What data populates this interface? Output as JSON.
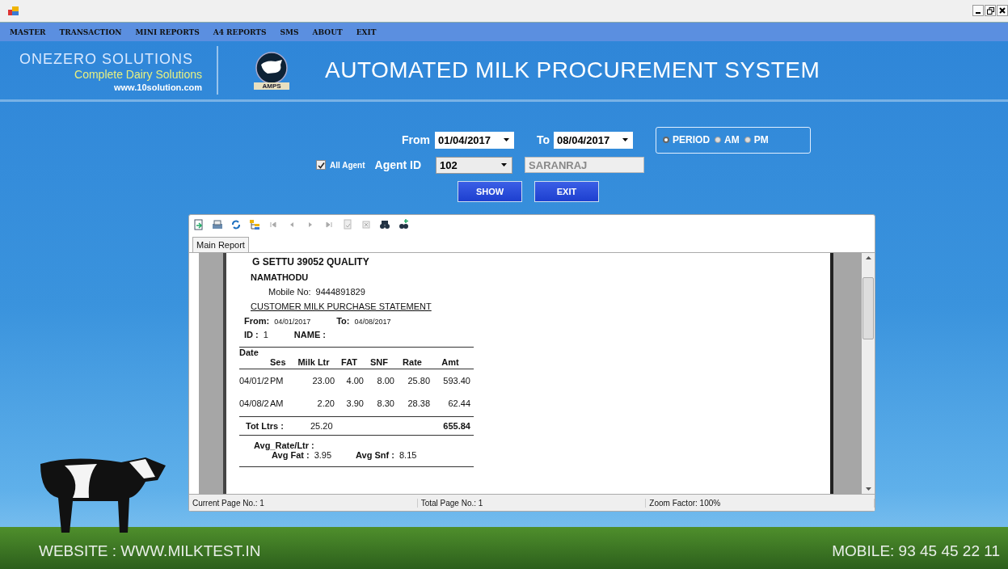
{
  "menu": [
    "MASTER",
    "TRANSACTION",
    "MINI REPORTS",
    "A4 REPORTS",
    "SMS",
    "ABOUT",
    "EXIT"
  ],
  "header": {
    "company": "ONEZERO SOLUTIONS",
    "tagline": "Complete Dairy Solutions",
    "website": "www.10solution.com",
    "logo_text": "AMPS",
    "title": "AUTOMATED MILK PROCUREMENT SYSTEM"
  },
  "filter": {
    "from_label": "From",
    "from_value": "01/04/2017",
    "to_label": "To",
    "to_value": "08/04/2017",
    "sessions": [
      {
        "label": "PERIOD",
        "selected": true
      },
      {
        "label": "AM",
        "selected": false
      },
      {
        "label": "PM",
        "selected": false
      }
    ],
    "all_agent": {
      "label": "All Agent",
      "checked": true
    },
    "agent_label": "Agent ID",
    "agent_id": "102",
    "agent_name": "SARANRAJ",
    "buttons": [
      "SHOW",
      "EXIT"
    ]
  },
  "report_viewer": {
    "tab": "Main Report",
    "report": {
      "company": "G SETTU 39052 QUALITY",
      "place": "NAMATHODU",
      "mobile_label": "Mobile No:",
      "mobile": "9444891829",
      "heading": "CUSTOMER MILK PURCHASE STATEMENT",
      "from_label": "From:",
      "from": "04/01/2017",
      "to_label": "To:",
      "to": "04/08/2017",
      "id_label": "ID :",
      "id": "1",
      "name_label": "NAME :",
      "columns": [
        "Date",
        "Ses",
        "Milk Ltr",
        "FAT",
        "SNF",
        "Rate",
        "Amt"
      ],
      "rows": [
        [
          "04/01/2",
          "PM",
          "23.00",
          "4.00",
          "8.00",
          "25.80",
          "593.40"
        ],
        [
          "04/08/2",
          "AM",
          "2.20",
          "3.90",
          "8.30",
          "28.38",
          "62.44"
        ]
      ],
      "tot_label": "Tot Ltrs :",
      "tot_ltrs": "25.20",
      "tot_amt": "655.84",
      "avg_rate_label": "Avg_Rate/Ltr :",
      "avg_fat_label": "Avg Fat :",
      "avg_fat": "3.95",
      "avg_snf_label": "Avg Snf :",
      "avg_snf": "8.15"
    },
    "status": [
      "Current Page No.: 1",
      "Total Page No.: 1",
      "Zoom Factor: 100%"
    ]
  },
  "footer": {
    "website": "WEBSITE : WWW.MILKTEST.IN",
    "mobile": "MOBILE: 93 45 45 22 11"
  }
}
